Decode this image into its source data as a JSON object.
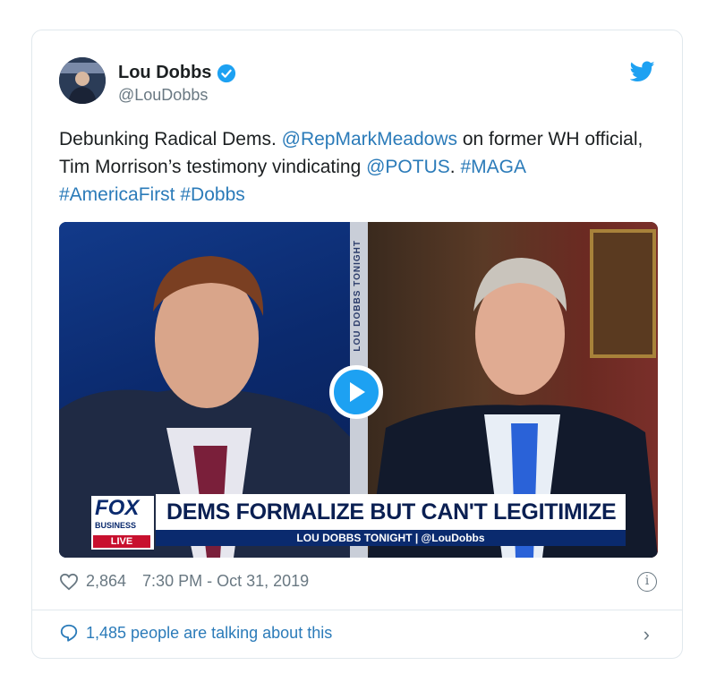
{
  "tweet": {
    "author_name": "Lou Dobbs",
    "author_handle": "@LouDobbs",
    "text": {
      "t1": "Debunking Radical Dems. ",
      "mention1": "@RepMarkMeadows",
      "t2": " on former WH official, Tim Morrison’s testimony vindicating ",
      "mention2": "@POTUS",
      "t3": ". ",
      "hashtag1": "#MAGA",
      "hashtag2": "#AmericaFirst",
      "hashtag3": "#Dobbs"
    },
    "likes": "2,864",
    "timestamp": "7:30 PM - Oct 31, 2019",
    "talking": "1,485 people are talking about this"
  },
  "video": {
    "divider_text": "LOU DOBBS TONIGHT",
    "logo_word": "FOX",
    "logo_sub": "BUSINESS",
    "live_label": "LIVE",
    "headline": "DEMS FORMALIZE BUT CAN'T LEGITIMIZE",
    "show_line": "LOU DOBBS TONIGHT | @LouDobbs"
  },
  "colors": {
    "link": "#2b7bb9",
    "twitter_blue": "#1da1f2",
    "muted": "#697882"
  },
  "icons": [
    "verified-icon",
    "twitter-bird-icon",
    "play-icon",
    "heart-icon",
    "info-icon",
    "speech-bubble-icon",
    "chevron-right-icon"
  ]
}
